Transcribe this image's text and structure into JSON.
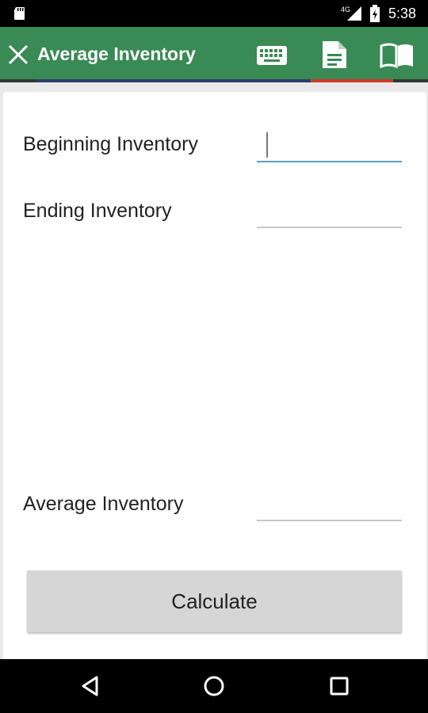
{
  "status_bar": {
    "time": "5:38",
    "network": "4G"
  },
  "app_bar": {
    "title": "Average Inventory",
    "tabs": [
      "keyboard-icon",
      "document-icon",
      "book-icon"
    ],
    "active_tab": "document-icon",
    "colors": {
      "bar": "#3a8a55",
      "indicator": "#d33a2c"
    }
  },
  "form": {
    "beginning_label": "Beginning Inventory",
    "beginning_value": "",
    "ending_label": "Ending Inventory",
    "ending_value": "",
    "average_label": "Average Inventory",
    "average_value": ""
  },
  "calculate_button": "Calculate"
}
